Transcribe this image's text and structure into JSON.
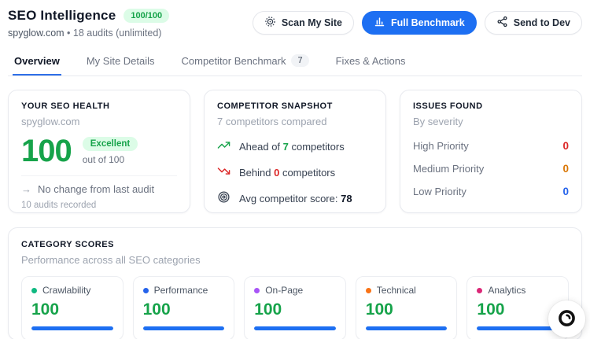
{
  "header": {
    "title": "SEO Intelligence",
    "score_badge": "100/100",
    "domain": "spyglow.com",
    "audits_info": "• 18 audits (unlimited)",
    "buttons": {
      "scan_label": "Scan My Site",
      "benchmark_label": "Full Benchmark",
      "send_label": "Send to Dev"
    }
  },
  "tabs": [
    {
      "label": "Overview",
      "active": true
    },
    {
      "label": "My Site Details",
      "active": false
    },
    {
      "label": "Competitor Benchmark",
      "badge": "7",
      "active": false
    },
    {
      "label": "Fixes & Actions",
      "active": false
    }
  ],
  "seo_health": {
    "title": "YOUR SEO HEALTH",
    "domain": "spyglow.com",
    "score": "100",
    "rating": "Excellent",
    "out_of": "out of 100",
    "change_arrow": "→",
    "change_text": "No change from last audit",
    "audits_recorded": "10 audits recorded"
  },
  "competitor_snapshot": {
    "title": "COMPETITOR SNAPSHOT",
    "subtitle": "7 competitors compared",
    "rows": [
      {
        "icon": "trending-up-icon",
        "prefix": "Ahead of ",
        "value": "7",
        "suffix": " competitors",
        "value_color": "#16a34a"
      },
      {
        "icon": "trending-down-icon",
        "prefix": "Behind ",
        "value": "0",
        "suffix": " competitors",
        "value_color": "#dc2626"
      },
      {
        "icon": "target-icon",
        "prefix": "Avg competitor score: ",
        "value": "78",
        "suffix": "",
        "value_color": "#111827"
      }
    ]
  },
  "issues_found": {
    "title": "ISSUES FOUND",
    "subtitle": "By severity",
    "rows": [
      {
        "label": "High Priority",
        "value": "0",
        "color": "#dc2626"
      },
      {
        "label": "Medium Priority",
        "value": "0",
        "color": "#d97706"
      },
      {
        "label": "Low Priority",
        "value": "0",
        "color": "#2563eb"
      }
    ]
  },
  "category_scores": {
    "title": "CATEGORY SCORES",
    "subtitle": "Performance across all SEO categories",
    "bar_color": "#1d6ff2",
    "categories": [
      {
        "label": "Crawlability",
        "score": "100",
        "dot_color": "#10b981",
        "progress": 100
      },
      {
        "label": "Performance",
        "score": "100",
        "dot_color": "#2563eb",
        "progress": 100
      },
      {
        "label": "On-Page",
        "score": "100",
        "dot_color": "#a855f7",
        "progress": 100
      },
      {
        "label": "Technical",
        "score": "100",
        "dot_color": "#f97316",
        "progress": 100
      },
      {
        "label": "Analytics",
        "score": "100",
        "dot_color": "#db2777",
        "progress": 100
      }
    ]
  },
  "colors": {
    "accent_blue": "#1d6ff2",
    "success_green": "#16a34a",
    "success_bg": "#dcfce7",
    "danger_red": "#dc2626",
    "warning_orange": "#d97706"
  },
  "fab": {
    "icon": "ring-record-icon"
  }
}
